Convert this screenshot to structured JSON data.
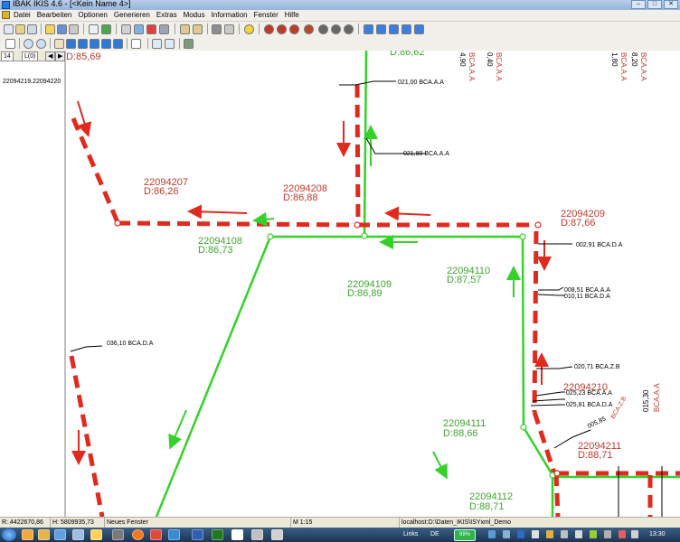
{
  "window": {
    "title": "IBAK IKIS 4.6 - [<Kein Name 4>]"
  },
  "menu": [
    "Datei",
    "Bearbeiten",
    "Optionen",
    "Generieren",
    "Extras",
    "Modus",
    "Information",
    "Fenster",
    "Hilfe"
  ],
  "panel": {
    "tabs": [
      "14",
      "L(0)"
    ],
    "entry": "22094219.22094220"
  },
  "colors": {
    "red": "#e02a1e",
    "green": "#35d12a",
    "text_red": "#c0392b",
    "text_green": "#3fa52f"
  },
  "map": {
    "labels": [
      {
        "id": "22094207",
        "text": "22094207",
        "depth": "D:86,26"
      },
      {
        "id": "22094208",
        "text": "22094208",
        "depth": "D:86,88"
      },
      {
        "id": "22094209",
        "text": "22094209",
        "depth": "D:87,66"
      },
      {
        "id": "22094108",
        "text": "22094108",
        "depth": "D:86,73"
      },
      {
        "id": "22094109",
        "text": "22094109",
        "depth": "D:86,89"
      },
      {
        "id": "22094110",
        "text": "22094110",
        "depth": "D:87,57"
      },
      {
        "id": "22094111",
        "text": "22094111",
        "depth": "D:88,66"
      },
      {
        "id": "22094112",
        "text": "22094112",
        "depth": "D:88,71"
      },
      {
        "id": "22094211",
        "text": "22094211",
        "depth": "D:88,71"
      },
      {
        "id": "22094210",
        "text": "22094210",
        "depth": ""
      }
    ],
    "top_depth": "D:85,69",
    "top_green_frag": "D:86,62",
    "annotations": [
      "021,00 BCA.A.A",
      "021,80 BCA.A.A",
      "002,91 BCA.D.A",
      "008,51 BCA.A.A",
      "010,11 BCA.D.A",
      "036,10 BCA.D.A",
      "020,71 BCA.Z.B",
      "005,85",
      "BCA.Z.B",
      "025,23 BCA.A.A",
      "025,81 BCA.D.A"
    ],
    "vertical_labels": [
      "4,90",
      "BCA.A.A",
      "0,40",
      "BCA.A.A",
      "1,80",
      "BCA.A.A",
      "8,20",
      "BCA.A.A",
      "015,30",
      "BCA.A.A"
    ]
  },
  "status": {
    "x": "R: 4422670,86",
    "y": "H: 5809935,73",
    "window": "Neues Fenster",
    "scale": "M 1:15",
    "path": "localhost:D:\\Daten_IKIS\\ISYxml_Demo"
  },
  "taskbar": {
    "links": "Links",
    "lang": "DE",
    "battery": "99%",
    "time": "13:30"
  }
}
